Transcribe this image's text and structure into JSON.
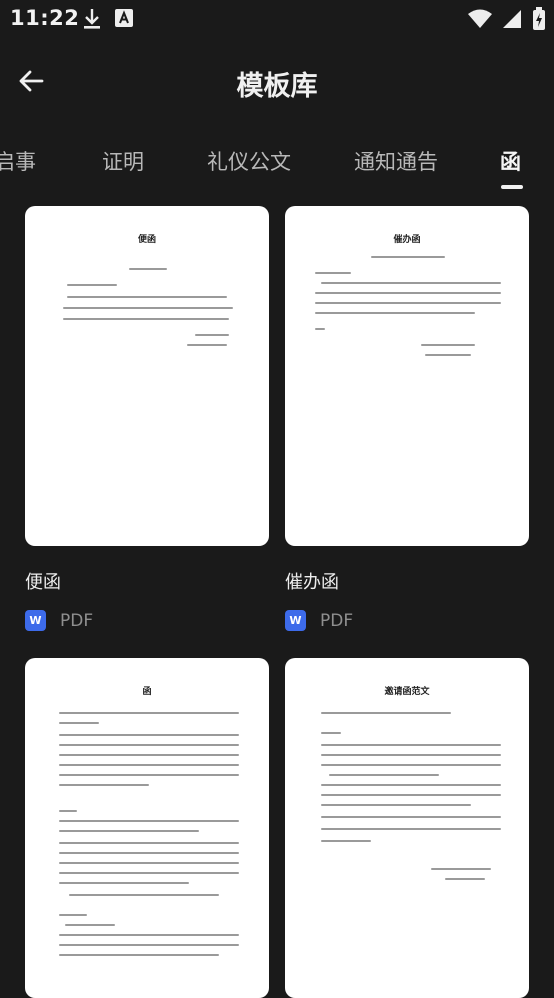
{
  "status": {
    "time": "11:22",
    "left_icons": [
      "download-icon",
      "font-app-icon"
    ],
    "right_icons": [
      "wifi-icon",
      "signal-icon",
      "battery-icon"
    ]
  },
  "header": {
    "title": "模板库",
    "back_icon": "back-arrow-icon"
  },
  "tabs": [
    {
      "label": "启事"
    },
    {
      "label": "证明"
    },
    {
      "label": "礼仪公文"
    },
    {
      "label": "通知通告"
    },
    {
      "label": "函",
      "active": true
    }
  ],
  "templates": [
    {
      "name": "便函",
      "type": "PDF",
      "badge": "W",
      "doc_title": "便函"
    },
    {
      "name": "催办函",
      "type": "PDF",
      "badge": "W",
      "doc_title": "催办函"
    },
    {
      "name": "",
      "type": "",
      "badge": "",
      "doc_title": "函"
    },
    {
      "name": "",
      "type": "",
      "badge": "",
      "doc_title": "邀请函范文"
    }
  ],
  "colors": {
    "background": "#1a1a1a",
    "accent_badge": "#3d6bea",
    "tab_active": "#f5f5f5",
    "tab_inactive": "#b8b8b8"
  }
}
